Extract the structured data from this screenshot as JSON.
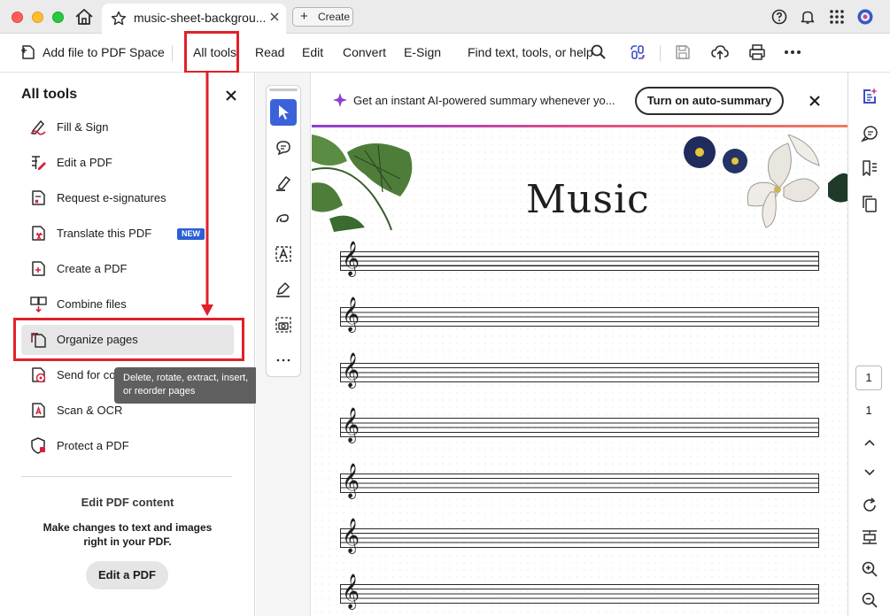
{
  "window": {
    "tab_title": "music-sheet-backgrou...",
    "create_label": "Create"
  },
  "toolbar": {
    "add_file_label": "Add file to PDF Space",
    "all_tools_label": "All tools",
    "read_label": "Read",
    "edit_label": "Edit",
    "convert_label": "Convert",
    "esign_label": "E-Sign",
    "search_label": "Find text, tools, or help"
  },
  "panel": {
    "title": "All tools",
    "tools": [
      {
        "label": "Fill & Sign",
        "icon": "fill-sign-icon"
      },
      {
        "label": "Edit a PDF",
        "icon": "edit-pdf-icon"
      },
      {
        "label": "Request e-signatures",
        "icon": "request-esign-icon"
      },
      {
        "label": "Translate this PDF",
        "icon": "translate-icon",
        "badge": "NEW"
      },
      {
        "label": "Create a PDF",
        "icon": "create-pdf-icon"
      },
      {
        "label": "Combine files",
        "icon": "combine-icon"
      },
      {
        "label": "Organize pages",
        "icon": "organize-pages-icon"
      },
      {
        "label": "Send for co",
        "icon": "send-comments-icon"
      },
      {
        "label": "Scan & OCR",
        "icon": "scan-ocr-icon"
      },
      {
        "label": "Protect a PDF",
        "icon": "protect-icon"
      }
    ],
    "tooltip": "Delete, rotate, extract, insert, or reorder pages",
    "promo": {
      "title": "Edit PDF content",
      "description": "Make changes to text and images right in your PDF.",
      "button": "Edit a PDF"
    }
  },
  "banner": {
    "text": "Get an instant AI-powered summary whenever yo...",
    "button": "Turn on auto-summary"
  },
  "document": {
    "title": "Music"
  },
  "pager": {
    "current": "1",
    "total": "1"
  },
  "colors": {
    "accent_red": "#e0202a",
    "accent_blue": "#3b62d8",
    "badge_blue": "#2c5fd4"
  }
}
